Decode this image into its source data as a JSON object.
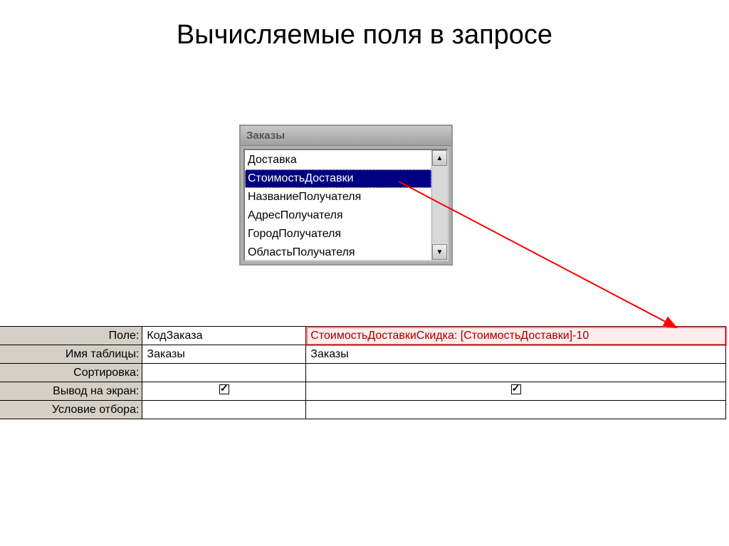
{
  "title": "Вычисляемые поля в запросе",
  "tableWidget": {
    "title": "Заказы",
    "fields": [
      "Доставка",
      "СтоимостьДоставки",
      "НазваниеПолучателя",
      "АдресПолучателя",
      "ГородПолучателя",
      "ОбластьПолучателя"
    ],
    "selectedIndex": 1
  },
  "grid": {
    "rows": {
      "field": "Поле:",
      "table": "Имя таблицы:",
      "sort": "Сортировка:",
      "show": "Вывод на экран:",
      "criteria": "Условие отбора:"
    },
    "col1": {
      "field": "КодЗаказа",
      "table": "Заказы",
      "sort": "",
      "show": true,
      "criteria": ""
    },
    "col2": {
      "field": "СтоимостьДоставкиСкидка: [СтоимостьДоставки]-10",
      "table": "Заказы",
      "sort": "",
      "show": true,
      "criteria": ""
    }
  }
}
